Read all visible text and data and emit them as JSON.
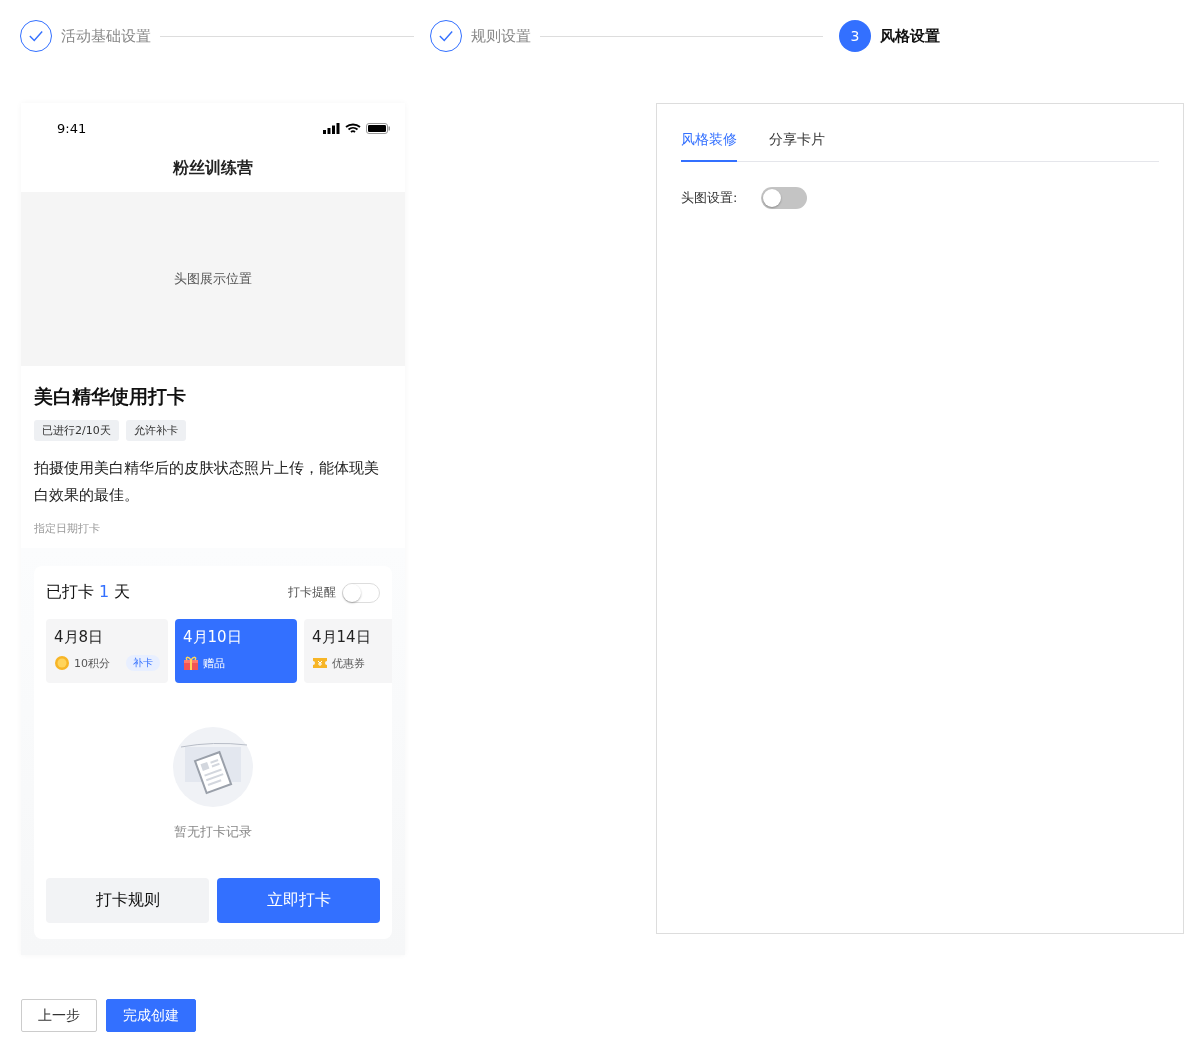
{
  "steps": [
    {
      "label": "活动基础设置",
      "kind": "done"
    },
    {
      "label": "规则设置",
      "kind": "done"
    },
    {
      "label": "风格设置",
      "kind": "current",
      "number": "3"
    }
  ],
  "phone": {
    "time": "9:41",
    "title": "粉丝训练营",
    "banner_text": "头图展示位置",
    "activity_title": "美白精华使用打卡",
    "tags": [
      "已进行2/10天",
      "允许补卡"
    ],
    "description": "拍摄使用美白精华后的皮肤状态照片上传，能体现美白效果的最佳。",
    "mode": "指定日期打卡",
    "checkin": {
      "prefix": "已打卡",
      "count": "1",
      "suffix": "天",
      "reminder_label": "打卡提醒",
      "reminder_on": false,
      "dates": [
        {
          "date": "4月8日",
          "kind": "points",
          "reward": "10积分",
          "makeup": "补卡",
          "selected": false
        },
        {
          "date": "4月10日",
          "kind": "gift",
          "reward": "赠品",
          "selected": true
        },
        {
          "date": "4月14日",
          "kind": "coupon",
          "reward": "优惠券",
          "selected": false
        }
      ],
      "empty_text": "暂无打卡记录",
      "rules_button": "打卡规则",
      "checkin_button": "立即打卡"
    }
  },
  "settings": {
    "tabs": [
      {
        "label": "风格装修",
        "selected": true
      },
      {
        "label": "分享卡片",
        "selected": false
      }
    ],
    "header_image_label": "头图设置:",
    "header_image_on": false
  },
  "footer": {
    "back_button": "上一步",
    "finish_button": "完成创建"
  }
}
